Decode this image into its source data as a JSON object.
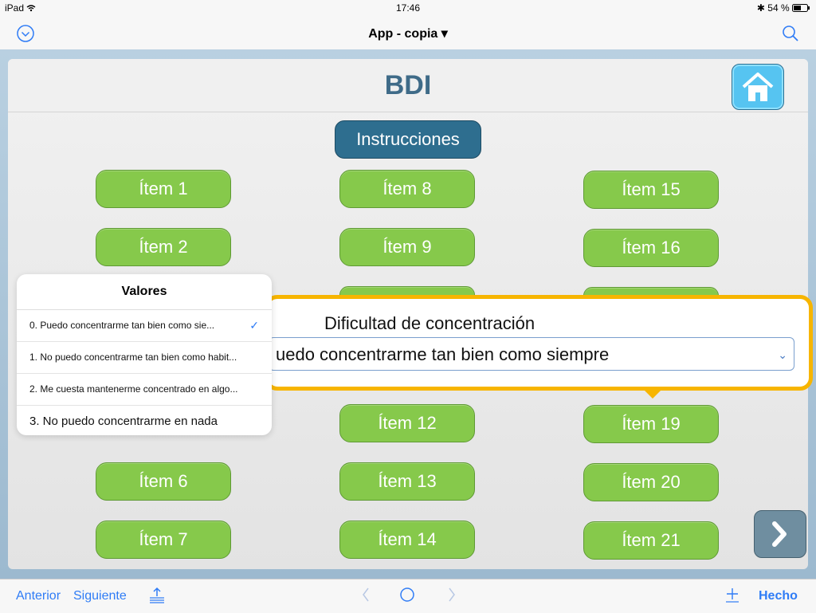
{
  "status": {
    "device": "iPad",
    "wifi": "wifi-icon",
    "time": "17:46",
    "battery": "54 %"
  },
  "nav": {
    "title": "App - copia",
    "title_caret": "▾"
  },
  "layout": {
    "header_title": "BDI",
    "instrucciones": "Instrucciones"
  },
  "items": {
    "i1": "Ítem 1",
    "i2": "Ítem 2",
    "i6": "Ítem 6",
    "i7": "Ítem 7",
    "i8": "Ítem 8",
    "i9": "Ítem 9",
    "i12": "Ítem 12",
    "i13": "Ítem 13",
    "i14": "Ítem 14",
    "i15": "Ítem 15",
    "i16": "Ítem 16",
    "i19": "Ítem 19",
    "i20": "Ítem 20",
    "i21": "Ítem 21"
  },
  "popover": {
    "title": "Dificultad de concentración",
    "selected": "uedo concentrarme tan bien como siempre"
  },
  "picker": {
    "title": "Valores",
    "options": [
      "0. Puedo concentrarme tan bien como sie...",
      "1. No puedo concentrarme tan bien como habit...",
      "2. Me cuesta mantenerme concentrado en algo...",
      "3. No puedo concentrarme en nada"
    ],
    "checked": "✓"
  },
  "toolbar": {
    "anterior": "Anterior",
    "siguiente": "Siguiente",
    "hecho": "Hecho"
  },
  "colors": {
    "accent": "#2f7cf6",
    "item_green": "#86c94b",
    "header_blue": "#3f6b88",
    "popover_border": "#f7b500"
  }
}
